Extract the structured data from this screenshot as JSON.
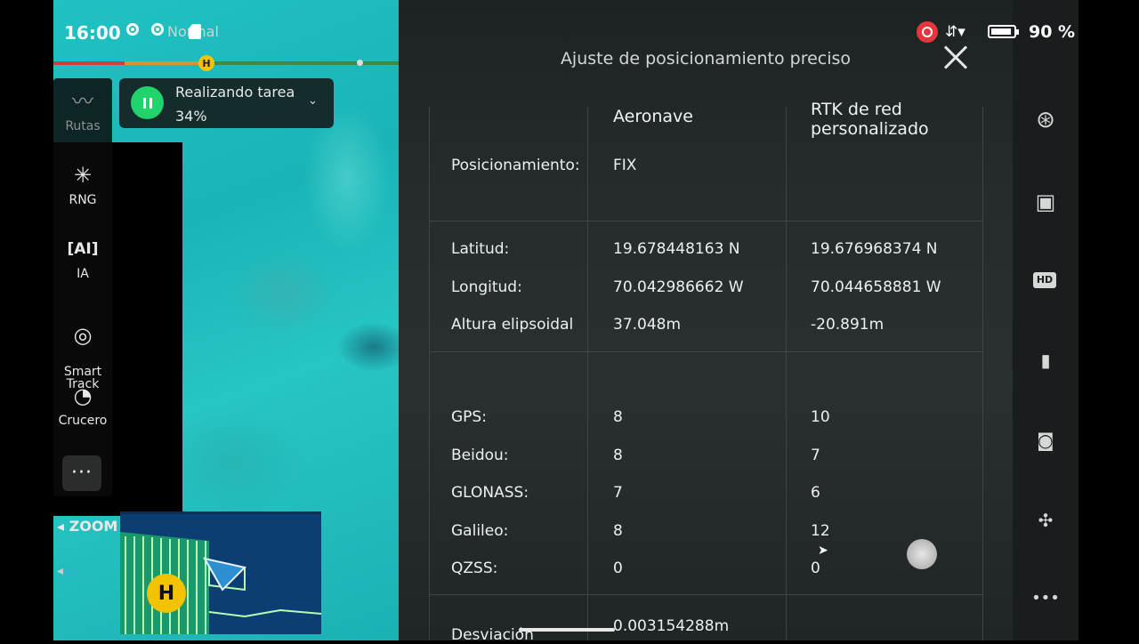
{
  "status_bar": {
    "time": "16:00",
    "mode": "Normal",
    "battery": "90 %"
  },
  "task": {
    "title": "Realizando tarea",
    "progress": "34%",
    "progress_value": 0.34
  },
  "toolbar": {
    "items": [
      {
        "label": "Rutas",
        "icon": "route-icon"
      },
      {
        "label": "RNG",
        "icon": "rng-icon"
      },
      {
        "label": "IA",
        "icon": "ai-icon"
      },
      {
        "label": "Smart\nTrack",
        "icon": "smart-track-icon"
      },
      {
        "label": "Crucero",
        "icon": "cruise-speedometer-icon"
      }
    ],
    "more": "···",
    "zoom": "ZOOM"
  },
  "minimap": {
    "home_marker": "H"
  },
  "dialog": {
    "title": "Ajuste de posicionamiento preciso",
    "columns": [
      "Aeronave",
      "RTK de red personalizado"
    ],
    "positioning": {
      "label": "Posicionamiento:",
      "aircraft": "FIX",
      "rtk": ""
    },
    "coordinates": [
      {
        "label": "Latitud:",
        "aircraft": "19.678448163 N",
        "rtk": "19.676968374 N"
      },
      {
        "label": "Longitud:",
        "aircraft": "70.042986662 W",
        "rtk": "70.044658881 W"
      },
      {
        "label": "Altura elipsoidal",
        "aircraft": "37.048m",
        "rtk": "-20.891m"
      }
    ],
    "satellites": [
      {
        "label": "GPS:",
        "aircraft": "8",
        "rtk": "10"
      },
      {
        "label": "Beidou:",
        "aircraft": "8",
        "rtk": "7"
      },
      {
        "label": "GLONASS:",
        "aircraft": "7",
        "rtk": "6"
      },
      {
        "label": "Galileo:",
        "aircraft": "8",
        "rtk": "12"
      },
      {
        "label": "QZSS:",
        "aircraft": "0",
        "rtk": "0"
      }
    ],
    "deviation": {
      "label": "Desviación",
      "aircraft": "0.003154288m"
    }
  },
  "colors": {
    "accent_green": "#20d36d",
    "record_red": "#e4363d",
    "home_yellow": "#f3c300"
  }
}
